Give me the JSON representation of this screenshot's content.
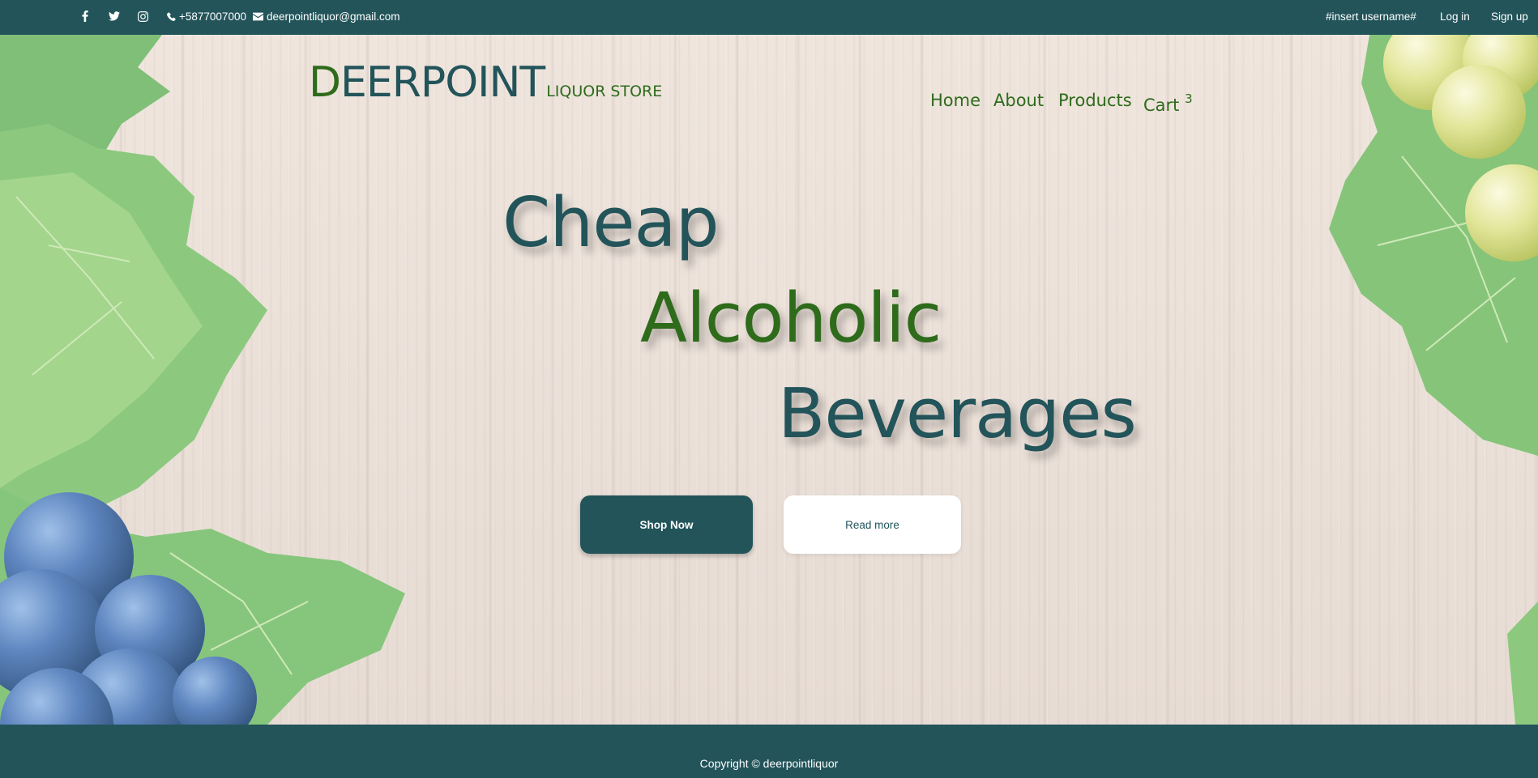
{
  "colors": {
    "primary": "#22545a",
    "accent_green": "#2e6b1b",
    "wood": "#ebdfd6",
    "white": "#ffffff"
  },
  "topbar": {
    "social_icons": [
      "facebook-icon",
      "twitter-icon",
      "instagram-icon"
    ],
    "phone_icon": "phone-icon",
    "phone": "+5877007000",
    "email_icon": "envelope-icon",
    "email": "deerpointliquor@gmail.com",
    "username": "#insert username#",
    "login": "Log in",
    "signup": "Sign up"
  },
  "brand": {
    "first_letter": "D",
    "rest": "EERPOINT",
    "subtitle": "LIQUOR STORE"
  },
  "nav": {
    "home": "Home",
    "about": "About",
    "products": "Products",
    "cart": "Cart",
    "cart_count": "3"
  },
  "hero": {
    "line1": "Cheap",
    "line2": "Alcoholic",
    "line3": "Beverages",
    "shop_now": "Shop Now",
    "read_more": "Read more"
  },
  "footer": {
    "copyright": "Copyright © deerpointliquor"
  }
}
